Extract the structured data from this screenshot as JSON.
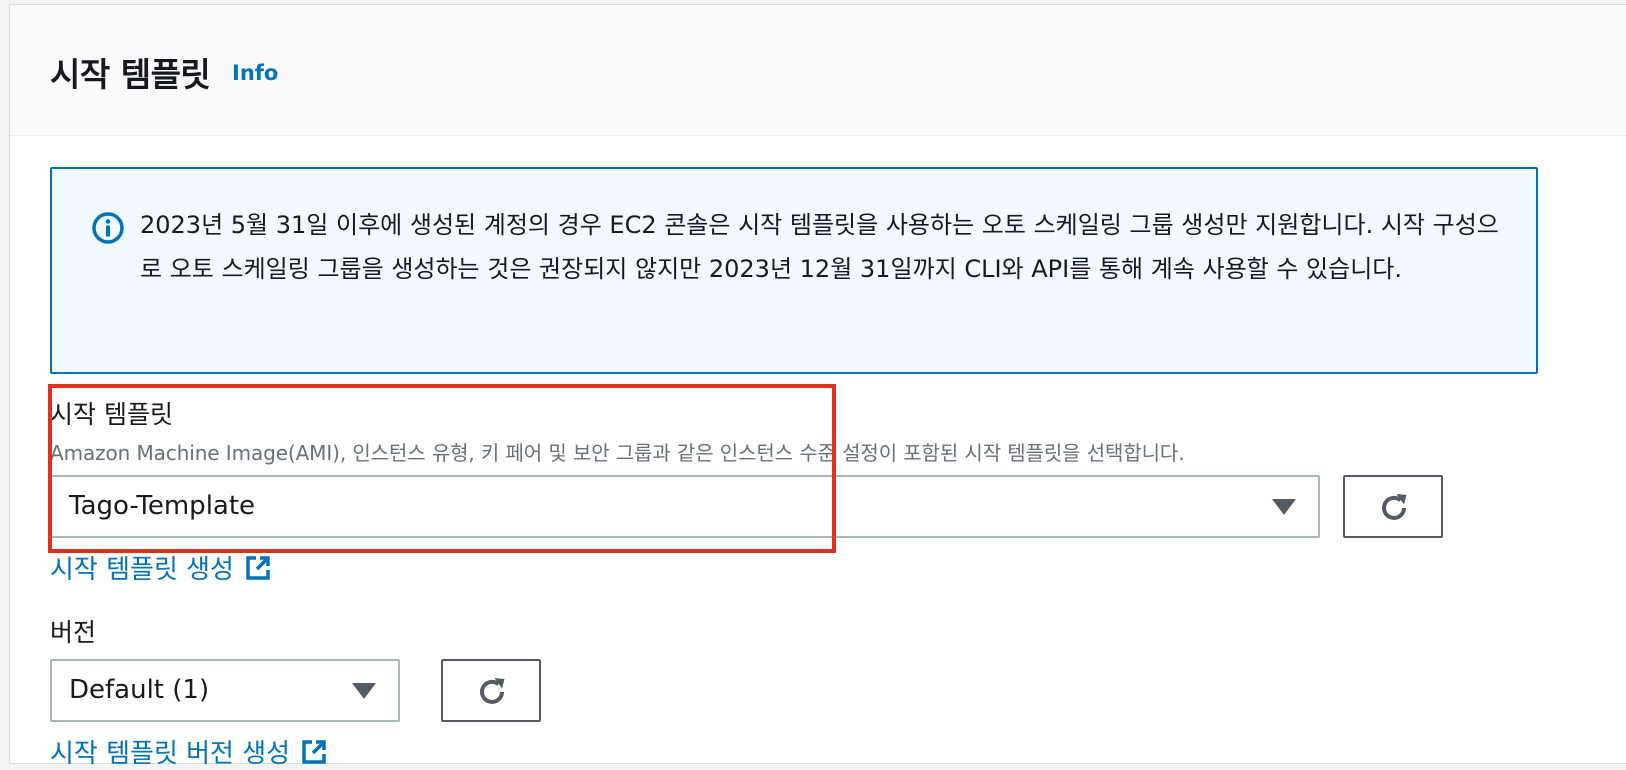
{
  "panel": {
    "title": "시작 템플릿",
    "info_label": "Info"
  },
  "alert": {
    "icon": "info-icon",
    "text": "2023년 5월 31일 이후에 생성된 계정의 경우 EC2 콘솔은 시작 템플릿을 사용하는 오토 스케일링 그룹 생성만 지원합니다. 시작 구성으로 오토 스케일링 그룹을 생성하는 것은 권장되지 않지만 2023년 12월 31일까지 CLI와 API를 통해 계속 사용할 수 있습니다."
  },
  "launch_template": {
    "label": "시작 템플릿",
    "description": "Amazon Machine Image(AMI), 인스턴스 유형, 키 페어 및 보안 그룹과 같은 인스턴스 수준 설정이 포함된 시작 템플릿을 선택합니다.",
    "selected": "Tago-Template",
    "create_link": "시작 템플릿 생성"
  },
  "version": {
    "label": "버전",
    "selected": "Default (1)",
    "create_link": "시작 템플릿 버전 생성"
  },
  "colors": {
    "link": "#0073bb",
    "alert_bg": "#f1faff",
    "highlight": "#e0301e"
  }
}
